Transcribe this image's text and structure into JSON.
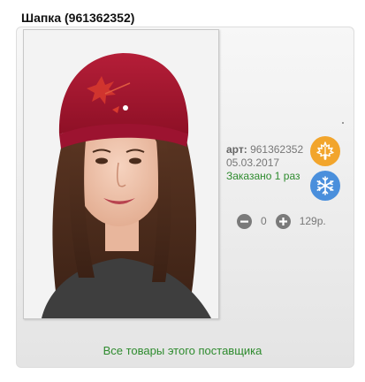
{
  "product": {
    "title": "Шапка (961362352)",
    "art_label": "арт:",
    "art_number": "961362352",
    "date": "05.03.2017",
    "ordered_text": "Заказано 1 раз",
    "photo_icon": "product-photo"
  },
  "seasons": {
    "autumn_icon": "maple-leaf-icon",
    "winter_icon": "snowflake-icon",
    "autumn_color": "#f2a52c",
    "winter_color": "#4a8fdc"
  },
  "quantity": {
    "value": "0",
    "price": "129р."
  },
  "footer": {
    "supplier_link": "Все товары этого поставщика"
  }
}
